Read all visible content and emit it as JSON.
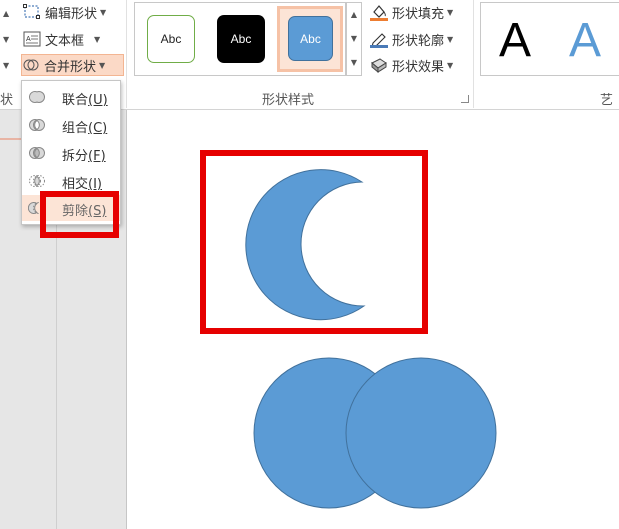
{
  "ribbon": {
    "edit_shape": "编辑形状",
    "text_box": "文本框",
    "merge_shapes": "合并形状",
    "left_cut_label": "状",
    "shape_styles_label": "形状样式",
    "wordart_cut_label": "艺",
    "shape_fill": "形状填充",
    "shape_outline": "形状轮廓",
    "shape_effects": "形状效果",
    "gallery": {
      "swatch1": "Abc",
      "swatch2": "Abc",
      "swatch3": "Abc"
    },
    "wordart": {
      "letter1": "A",
      "letter2": "A"
    }
  },
  "merge_menu": {
    "items": [
      {
        "label": "联合",
        "key": "(U)"
      },
      {
        "label": "组合",
        "key": "(C)"
      },
      {
        "label": "拆分",
        "key": "(F)"
      },
      {
        "label": "相交",
        "key": "(I)"
      },
      {
        "label": "剪除",
        "key": "(S)"
      }
    ]
  },
  "colors": {
    "shape_fill": "#5b9bd5",
    "shape_stroke": "#41719c",
    "annotation_red": "#e60000",
    "highlight": "#fce4d6"
  }
}
